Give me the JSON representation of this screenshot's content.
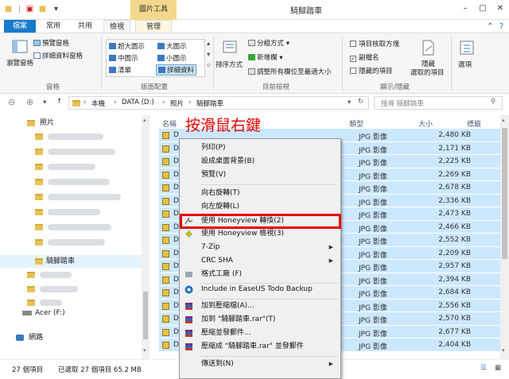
{
  "window": {
    "title": "騎腳踏車",
    "context_tab": "圖片工具"
  },
  "tabs": [
    "檔案",
    "常用",
    "共用",
    "檢視",
    "管理"
  ],
  "ribbon": {
    "pane_nav": "瀏覽窗格",
    "preview_pane": "預覽窗格",
    "details_pane": "詳細資料窗格",
    "group_panes": "窗格",
    "layout_items": [
      "超大圖示",
      "大圖示",
      "中圖示",
      "小圖示",
      "清單",
      "詳細資料"
    ],
    "group_layout": "版面配置",
    "sort_by": "排序方式",
    "group_by": "分組方式",
    "add_column": "新增欄",
    "fit_columns": "調整所有欄位至最適大小",
    "group_view": "目前檢視",
    "checkboxes": "項目核取方塊",
    "extensions": "副檔名",
    "hidden_items": "隱藏的項目",
    "hide_selected_1": "隱藏",
    "hide_selected_2": "選取的項目",
    "group_show": "顯示/隱藏",
    "options": "選項"
  },
  "address": {
    "crumbs": [
      "本機",
      "DATA (D:)",
      "照片",
      "騎腳踏車"
    ],
    "search_placeholder": "搜尋 騎腳踏車"
  },
  "nav": {
    "photos": "照片",
    "current": "騎腳踏車",
    "drive": "Acer (F:)",
    "network": "網路"
  },
  "columns": {
    "name": "名稱",
    "type": "類型",
    "size": "大小",
    "tags": "標籤"
  },
  "files": [
    {
      "type": "JPG 影像",
      "size": "2,480 KB"
    },
    {
      "type": "JPG 影像",
      "size": "2,171 KB"
    },
    {
      "type": "JPG 影像",
      "size": "2,225 KB"
    },
    {
      "type": "JPG 影像",
      "size": "2,269 KB"
    },
    {
      "type": "JPG 影像",
      "size": "2,678 KB"
    },
    {
      "type": "JPG 影像",
      "size": "2,336 KB"
    },
    {
      "type": "JPG 影像",
      "size": "2,473 KB"
    },
    {
      "type": "JPG 影像",
      "size": "2,466 KB"
    },
    {
      "type": "JPG 影像",
      "size": "2,552 KB"
    },
    {
      "type": "JPG 影像",
      "size": "2,209 KB"
    },
    {
      "type": "JPG 影像",
      "size": "2,957 KB"
    },
    {
      "type": "JPG 影像",
      "size": "2,394 KB"
    },
    {
      "type": "JPG 影像",
      "size": "2,684 KB"
    },
    {
      "type": "JPG 影像",
      "size": "2,556 KB"
    },
    {
      "type": "JPG 影像",
      "size": "2,570 KB"
    },
    {
      "type": "JPG 影像",
      "size": "2,677 KB"
    },
    {
      "type": "JPG 影像",
      "size": "2,404 KB"
    }
  ],
  "file_prefix": "D",
  "menu": {
    "print": "列印(P)",
    "set_bg": "設成桌面背景(B)",
    "preview": "預覽(V)",
    "rotate_right": "向右旋轉(T)",
    "rotate_left": "向左旋轉(L)",
    "hv_convert": "使用 Honeyview 轉換(2)",
    "hv_browse": "使用 Honeyview 檢視(3)",
    "zip": "7-Zip",
    "crc": "CRC SHA",
    "format_factory": "格式工廠 (F)",
    "easeus": "Include in EaseUS Todo Backup",
    "add_archive": "加到壓縮檔(A)...",
    "add_rar": "加到 \"騎腳踏車.rar\"(T)",
    "compress_email": "壓縮並發郵件...",
    "compress_rar_email": "壓縮成 \"騎腳踏車.rar\" 並發郵件",
    "send_to": "傳送到(N)"
  },
  "annotation": "按滑鼠右鍵",
  "status": {
    "count": "27 個項目",
    "selected": "已選取 27 個項目 65.2 MB"
  }
}
